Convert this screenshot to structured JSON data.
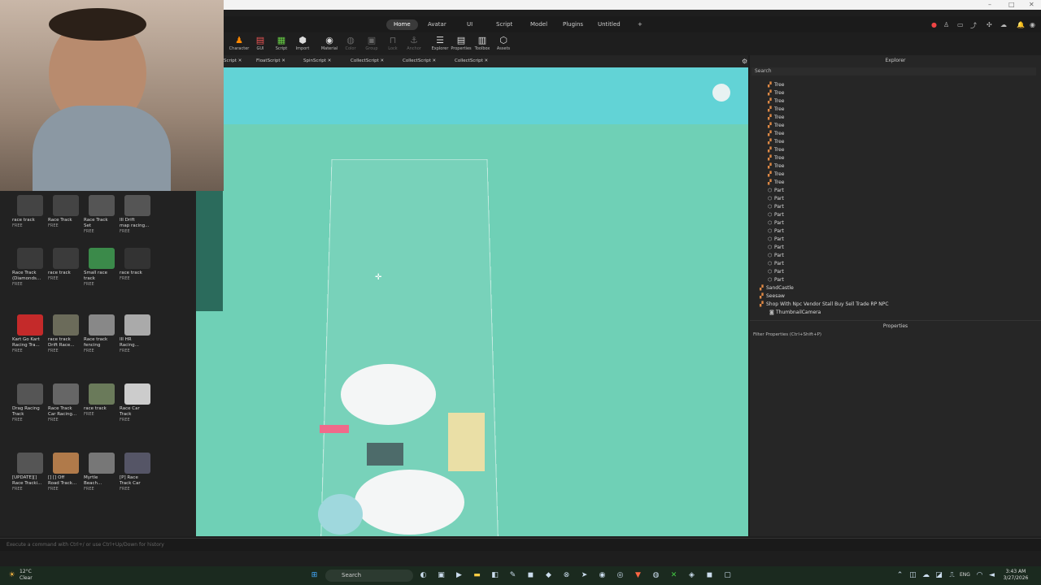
{
  "titlebar": {
    "controls": [
      "–",
      "□",
      "✕"
    ]
  },
  "menu": {
    "tabs": [
      "Home",
      "Avatar",
      "UI",
      "Script",
      "Model",
      "Plugins",
      "Untitled"
    ],
    "active": "Home",
    "more": "+"
  },
  "toolbar": {
    "tools": [
      {
        "label": "Character",
        "icon": "character-icon",
        "glyph": "♟"
      },
      {
        "label": "GUI",
        "icon": "gui-icon",
        "glyph": "▤"
      },
      {
        "label": "Script",
        "icon": "script-icon",
        "glyph": "▦"
      },
      {
        "label": "Import",
        "icon": "import-icon",
        "glyph": "⬢"
      },
      {
        "label": "Material",
        "icon": "material-icon",
        "glyph": "◉"
      },
      {
        "label": "Color",
        "icon": "color-icon",
        "glyph": "◍"
      },
      {
        "label": "Group",
        "icon": "group-icon",
        "glyph": "▣"
      },
      {
        "label": "Lock",
        "icon": "lock-icon",
        "glyph": "⊓"
      },
      {
        "label": "Anchor",
        "icon": "anchor-icon",
        "glyph": "⚓"
      },
      {
        "label": "Explorer",
        "icon": "explorer-icon",
        "glyph": "☰"
      },
      {
        "label": "Properties",
        "icon": "properties-icon",
        "glyph": "▤"
      },
      {
        "label": "Toolbox",
        "icon": "toolbox-icon",
        "glyph": "▥"
      },
      {
        "label": "Assets",
        "icon": "assets-icon",
        "glyph": "⬡"
      }
    ]
  },
  "doctabs": [
    "Script ✕",
    "FloatScript ✕",
    "SpinScript ✕",
    "CollectScript ✕",
    "CollectScript ✕",
    "CollectScript ✕"
  ],
  "toolbox": {
    "assets": [
      {
        "name": "race track",
        "price": "FREE",
        "color": "#444"
      },
      {
        "name": "Race Track",
        "price": "FREE",
        "color": "#444"
      },
      {
        "name": "Race Track\nSet",
        "price": "FREE",
        "color": "#555"
      },
      {
        "name": "III Drift\nmap racing...",
        "price": "FREE",
        "color": "#555"
      },
      {
        "name": "Race Track\n(Diamonds...",
        "price": "FREE",
        "color": "#3a3a3a"
      },
      {
        "name": "race track",
        "price": "FREE",
        "color": "#3b3b3b"
      },
      {
        "name": "Small race\ntrack",
        "price": "FREE",
        "color": "#3b8a4a"
      },
      {
        "name": "race track",
        "price": "FREE",
        "color": "#333"
      },
      {
        "name": "Kart Go Kart\nRacing Tra...",
        "price": "FREE",
        "color": "#c42a2a"
      },
      {
        "name": "race track\nDrift Race...",
        "price": "FREE",
        "color": "#6b6b5a"
      },
      {
        "name": "Race track\nfencing",
        "price": "FREE",
        "color": "#888"
      },
      {
        "name": "III HR\nRacing...",
        "price": "FREE",
        "color": "#aaa"
      },
      {
        "name": "Drag Racing\nTrack",
        "price": "FREE",
        "color": "#555"
      },
      {
        "name": "Race Track\nCar Racing...",
        "price": "FREE",
        "color": "#666"
      },
      {
        "name": "race track",
        "price": "FREE",
        "color": "#6a7a5a"
      },
      {
        "name": "Race Car\nTrack",
        "price": "FREE",
        "color": "#ccc"
      },
      {
        "name": "[UPDATE][]\nRace Tracki...",
        "price": "FREE",
        "color": "#555"
      },
      {
        "name": "[] [] Off\nRoad Track...",
        "price": "FREE",
        "color": "#b07a4a"
      },
      {
        "name": "Myrtle\nBeach...",
        "price": "FREE",
        "color": "#777"
      },
      {
        "name": "[P] Race\nTrack Car",
        "price": "FREE",
        "color": "#556"
      }
    ]
  },
  "command": {
    "placeholder": "Execute a command with Ctrl+/ or use Ctrl+Up/Down for history"
  },
  "explorer": {
    "title": "Explorer",
    "search": "Search",
    "items": [
      {
        "label": "Tree",
        "kind": "model"
      },
      {
        "label": "Tree",
        "kind": "model"
      },
      {
        "label": "Tree",
        "kind": "model"
      },
      {
        "label": "Tree",
        "kind": "model"
      },
      {
        "label": "Tree",
        "kind": "model"
      },
      {
        "label": "Tree",
        "kind": "model"
      },
      {
        "label": "Tree",
        "kind": "model"
      },
      {
        "label": "Tree",
        "kind": "model"
      },
      {
        "label": "Tree",
        "kind": "model"
      },
      {
        "label": "Tree",
        "kind": "model"
      },
      {
        "label": "Tree",
        "kind": "model"
      },
      {
        "label": "Tree",
        "kind": "model"
      },
      {
        "label": "Tree",
        "kind": "model"
      },
      {
        "label": "Part",
        "kind": "part"
      },
      {
        "label": "Part",
        "kind": "part"
      },
      {
        "label": "Part",
        "kind": "part"
      },
      {
        "label": "Part",
        "kind": "part"
      },
      {
        "label": "Part",
        "kind": "part"
      },
      {
        "label": "Part",
        "kind": "part"
      },
      {
        "label": "Part",
        "kind": "part"
      },
      {
        "label": "Part",
        "kind": "part"
      },
      {
        "label": "Part",
        "kind": "part"
      },
      {
        "label": "Part",
        "kind": "part"
      },
      {
        "label": "Part",
        "kind": "part"
      },
      {
        "label": "Part",
        "kind": "part"
      },
      {
        "label": "SandCastle",
        "kind": "model"
      },
      {
        "label": "Seesaw",
        "kind": "model"
      },
      {
        "label": "Shop With Npc Vendor Stall Buy Sell Trade RP NPC",
        "kind": "model"
      },
      {
        "label": "ThumbnailCamera",
        "kind": "camera"
      }
    ]
  },
  "properties": {
    "title": "Properties",
    "filter": "Filter Properties (Ctrl+Shift+P)"
  },
  "taskbar": {
    "weather_temp": "12°C",
    "weather_desc": "Clear",
    "search": "Search",
    "lang": "ENG",
    "time": "3:43 AM",
    "date": "3/27/2026"
  }
}
